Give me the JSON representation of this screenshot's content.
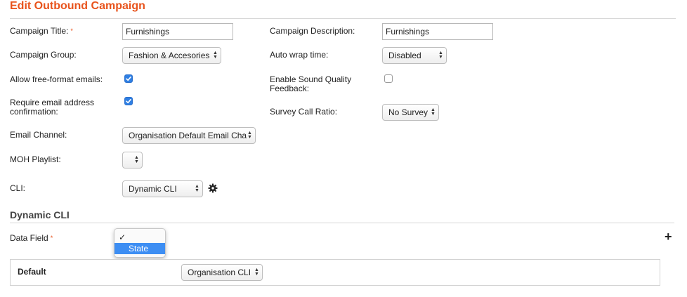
{
  "page": {
    "title": "Edit Outbound Campaign",
    "required_mark": "*"
  },
  "form": {
    "campaign_title": {
      "label": "Campaign Title:",
      "value": "Furnishings"
    },
    "campaign_description": {
      "label": "Campaign Description:",
      "value": "Furnishings"
    },
    "campaign_group": {
      "label": "Campaign Group:",
      "value": "Fashion & Accesories"
    },
    "auto_wrap_time": {
      "label": "Auto wrap time:",
      "value": "Disabled"
    },
    "free_format_emails": {
      "label": "Allow free-format emails:",
      "checked": true
    },
    "sound_quality_feedback": {
      "label_line1": "Enable Sound Quality",
      "label_line2": "Feedback:",
      "checked": false
    },
    "email_confirmation": {
      "label_line1": "Require email address",
      "label_line2": "confirmation:",
      "checked": true
    },
    "survey_call_ratio": {
      "label": "Survey Call Ratio:",
      "value": "No Survey"
    },
    "email_channel": {
      "label": "Email Channel:",
      "value": "Organisation Default Email Cha"
    },
    "moh_playlist": {
      "label": "MOH Playlist:",
      "value": ""
    },
    "cli": {
      "label": "CLI:",
      "value": "Dynamic CLI",
      "settings_icon": "gear-icon"
    }
  },
  "dynamic_cli": {
    "heading": "Dynamic CLI",
    "data_field": {
      "label": "Data Field",
      "options": [
        {
          "label": "",
          "checked": true,
          "highlighted": false
        },
        {
          "label": "State",
          "checked": false,
          "highlighted": true
        }
      ]
    },
    "add_icon": "plus-icon",
    "add_symbol": "+",
    "default_row": {
      "label": "Default",
      "value": "Organisation CLI"
    }
  },
  "colors": {
    "accent": "#e8531c",
    "highlight": "#3d8ef3",
    "checkbox": "#2f7fe3"
  }
}
